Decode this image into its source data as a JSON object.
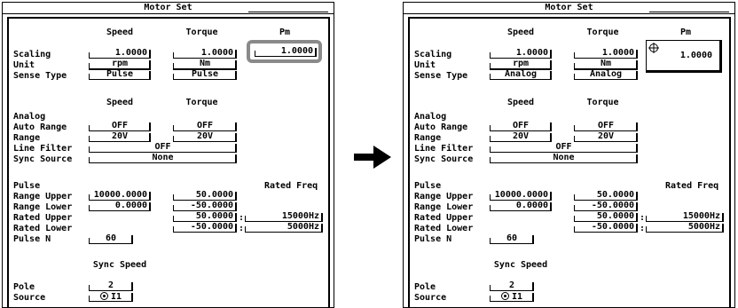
{
  "title": "Motor Set",
  "labels": {
    "scaling": "Scaling",
    "unit": "Unit",
    "sense_type": "Sense Type",
    "analog": "Analog",
    "auto_range": "Auto Range",
    "range": "Range",
    "line_filter": "Line Filter",
    "sync_source": "Sync Source",
    "pulse": "Pulse",
    "range_upper": "Range Upper",
    "range_lower": "Range Lower",
    "rated_upper": "Rated Upper",
    "rated_lower": "Rated Lower",
    "pulse_n": "Pulse N",
    "pole": "Pole",
    "source": "Source"
  },
  "headers": {
    "speed": "Speed",
    "torque": "Torque",
    "pm": "Pm",
    "rated_freq": "Rated Freq",
    "sync_speed": "Sync Speed"
  },
  "left": {
    "scaling_speed": "1.0000",
    "scaling_torque": "1.0000",
    "scaling_pm": "1.0000",
    "unit_speed": "rpm",
    "unit_torque": "Nm",
    "sense_speed": "Pulse",
    "sense_torque": "Pulse",
    "auto_range_speed": "OFF",
    "auto_range_torque": "OFF",
    "range_speed": "20V",
    "range_torque": "20V",
    "line_filter": "OFF",
    "sync_source": "None",
    "range_upper_speed": "10000.0000",
    "range_lower_speed": "0.0000",
    "range_upper_torque": "50.0000",
    "range_lower_torque": "-50.0000",
    "rated_upper_torque": "50.0000",
    "rated_lower_torque": "-50.0000",
    "rated_upper_freq": "15000Hz",
    "rated_lower_freq": "5000Hz",
    "pulse_n": "60",
    "pole": "2",
    "source": "I1"
  },
  "right": {
    "scaling_speed": "1.0000",
    "scaling_torque": "1.0000",
    "pm_value": "1.0000",
    "unit_speed": "rpm",
    "unit_torque": "Nm",
    "sense_speed": "Analog",
    "sense_torque": "Analog",
    "auto_range_speed": "OFF",
    "auto_range_torque": "OFF",
    "range_speed": "20V",
    "range_torque": "20V",
    "line_filter": "OFF",
    "sync_source": "None",
    "range_upper_speed": "10000.0000",
    "range_lower_speed": "0.0000",
    "range_upper_torque": "50.0000",
    "range_lower_torque": "-50.0000",
    "rated_upper_torque": "50.0000",
    "rated_lower_torque": "-50.0000",
    "rated_upper_freq": "15000Hz",
    "rated_lower_freq": "5000Hz",
    "pulse_n": "60",
    "pole": "2",
    "source": "I1"
  },
  "icons": {
    "transition": "right-arrow-icon",
    "edit_cursor": "crosshair-icon",
    "source_radio": "radio-icon"
  }
}
